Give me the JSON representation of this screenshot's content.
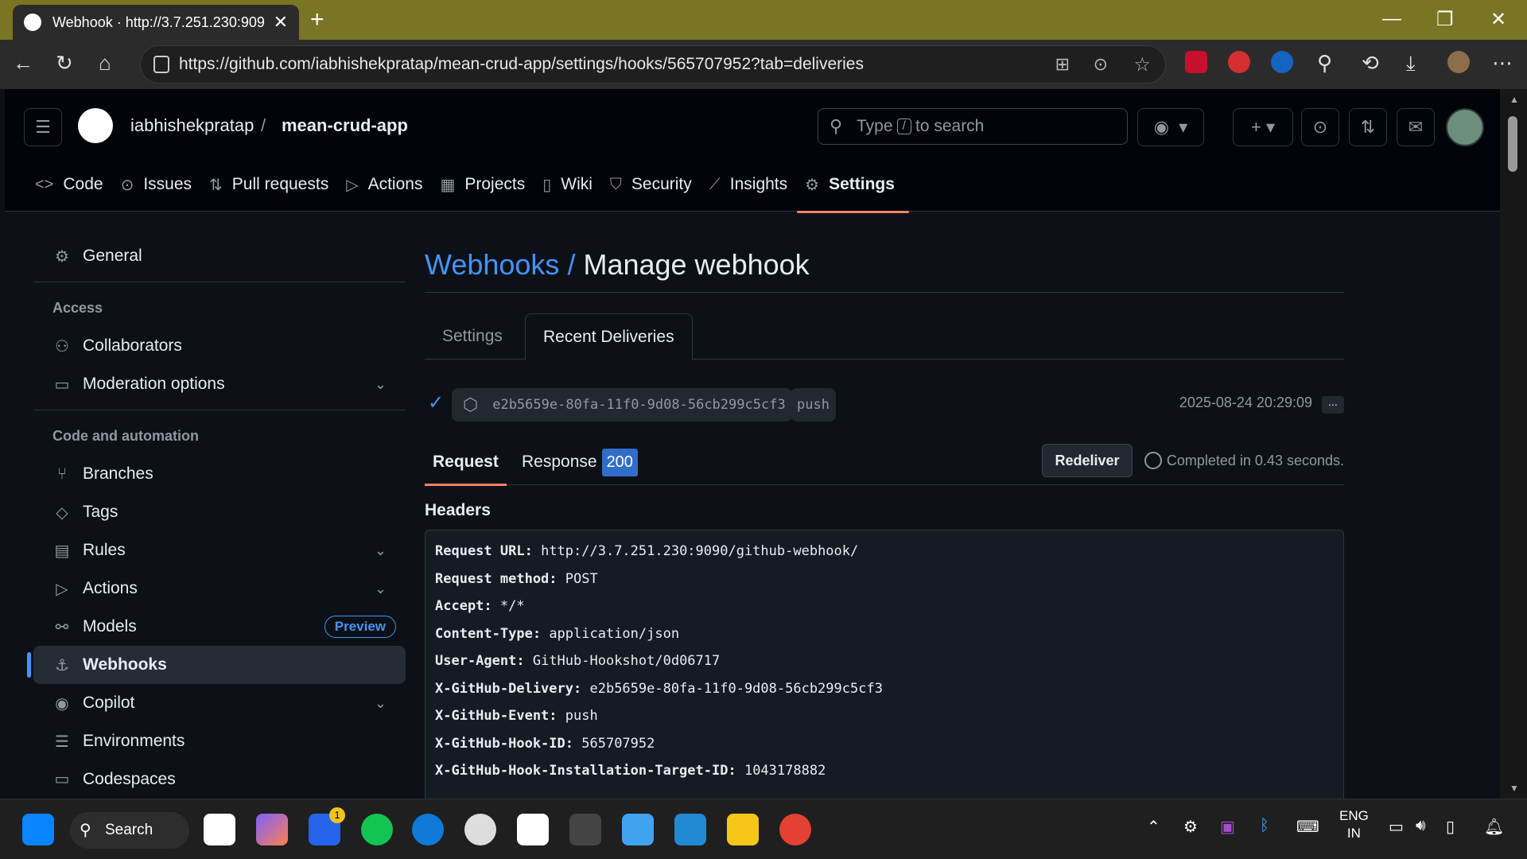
{
  "browser": {
    "tab_title": "Webhook · http://3.7.251.230:909(",
    "url": "https://github.com/iabhishekpratap/mean-crud-app/settings/hooks/565707952?tab=deliveries"
  },
  "header": {
    "owner": "iabhishekpratap",
    "separator": "/",
    "repo": "mean-crud-app",
    "search_prefix": "Type",
    "search_key": "/",
    "search_suffix": "to search"
  },
  "repo_nav": [
    {
      "label": "Code",
      "icon": "code-icon"
    },
    {
      "label": "Issues",
      "icon": "issue-icon"
    },
    {
      "label": "Pull requests",
      "icon": "pull-request-icon"
    },
    {
      "label": "Actions",
      "icon": "play-icon"
    },
    {
      "label": "Projects",
      "icon": "table-icon"
    },
    {
      "label": "Wiki",
      "icon": "book-icon"
    },
    {
      "label": "Security",
      "icon": "shield-icon"
    },
    {
      "label": "Insights",
      "icon": "graph-icon"
    },
    {
      "label": "Settings",
      "icon": "gear-icon"
    }
  ],
  "sidebar": {
    "general": "General",
    "access_heading": "Access",
    "collaborators": "Collaborators",
    "moderation": "Moderation options",
    "code_heading": "Code and automation",
    "branches": "Branches",
    "tags": "Tags",
    "rules": "Rules",
    "actions": "Actions",
    "models": "Models",
    "models_badge": "Preview",
    "webhooks": "Webhooks",
    "copilot": "Copilot",
    "environments": "Environments",
    "codespaces": "Codespaces"
  },
  "main": {
    "breadcrumb_link": "Webhooks",
    "breadcrumb_sep": "/",
    "title": "Manage webhook",
    "tab_settings": "Settings",
    "tab_deliveries": "Recent Deliveries",
    "delivery_guid": "e2b5659e-80fa-11f0-9d08-56cb299c5cf3",
    "delivery_event": "push",
    "delivery_time": "2025-08-24 20:29:09",
    "more": "...",
    "subtab_request": "Request",
    "subtab_response": "Response",
    "response_code": "200",
    "redeliver": "Redeliver",
    "completed": "Completed in 0.43 seconds.",
    "headers_title": "Headers",
    "headers": [
      {
        "k": "Request URL:",
        "v": "http://3.7.251.230:9090/github-webhook/"
      },
      {
        "k": "Request method:",
        "v": "POST"
      },
      {
        "k": "Accept:",
        "v": "*/*"
      },
      {
        "k": "Content-Type:",
        "v": "application/json"
      },
      {
        "k": "User-Agent:",
        "v": "GitHub-Hookshot/0d06717"
      },
      {
        "k": "X-GitHub-Delivery:",
        "v": "e2b5659e-80fa-11f0-9d08-56cb299c5cf3"
      },
      {
        "k": "X-GitHub-Event:",
        "v": "push"
      },
      {
        "k": "X-GitHub-Hook-ID:",
        "v": "565707952"
      },
      {
        "k": "X-GitHub-Hook-Installation-Target-ID:",
        "v": "1043178882"
      }
    ]
  },
  "taskbar": {
    "search": "Search",
    "lang1": "ENG",
    "lang2": "IN",
    "badge": "1"
  }
}
